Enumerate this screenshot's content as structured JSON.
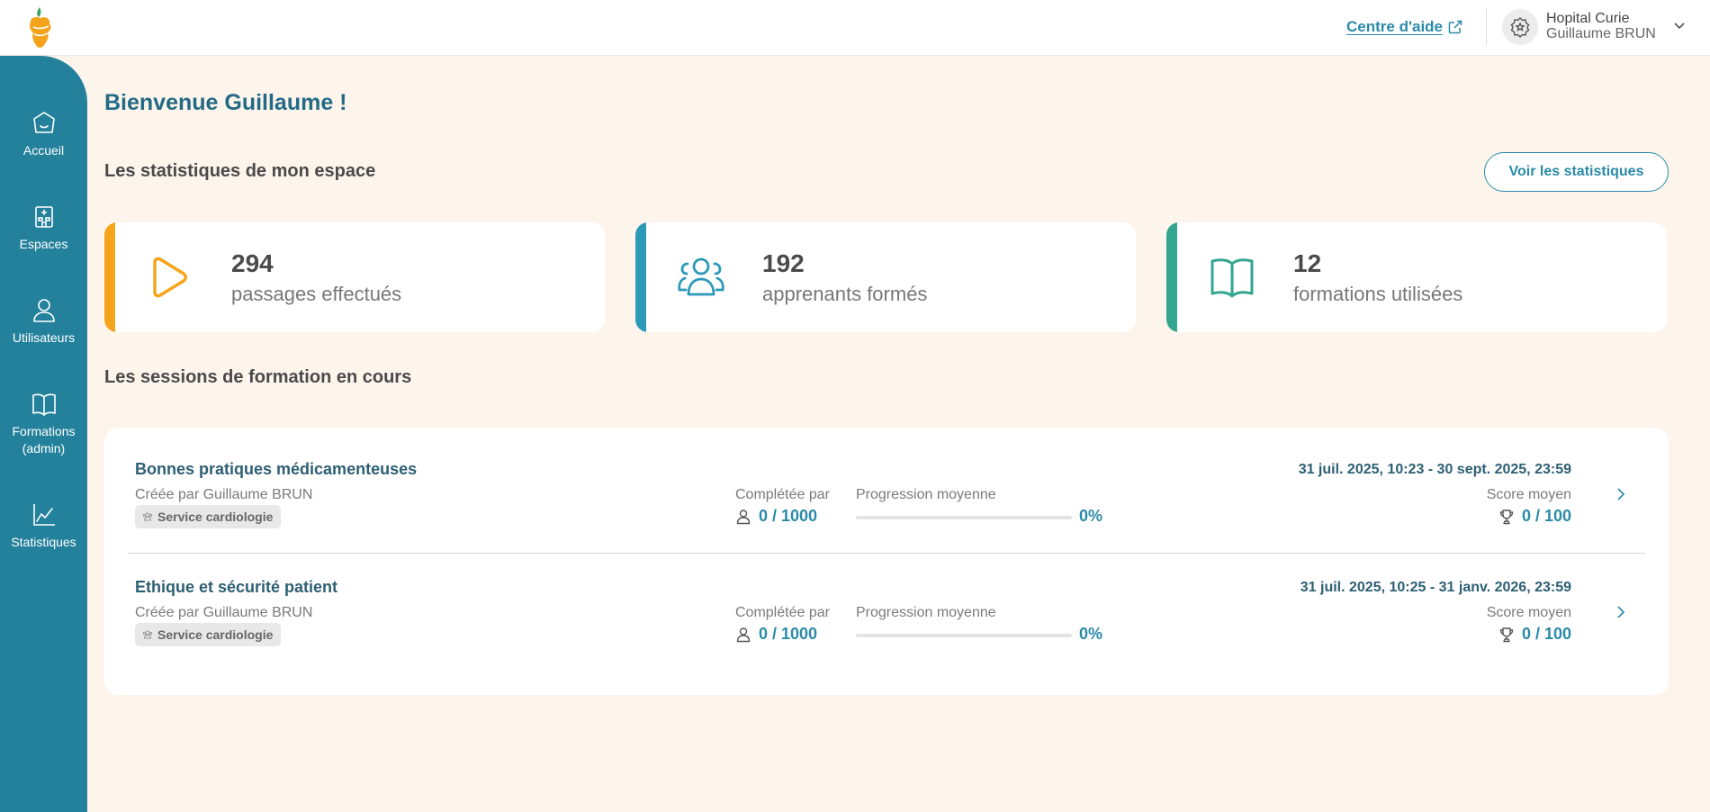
{
  "header": {
    "help_link": "Centre d'aide",
    "organization": "Hopital Curie",
    "user_name": "Guillaume BRUN"
  },
  "sidebar": {
    "items": [
      {
        "label": "Accueil",
        "icon": "home-icon"
      },
      {
        "label": "Espaces",
        "icon": "hospital-icon"
      },
      {
        "label": "Utilisateurs",
        "icon": "user-icon"
      },
      {
        "label": "Formations\n(admin)",
        "icon": "book-icon"
      },
      {
        "label": "Statistiques",
        "icon": "chart-icon"
      }
    ]
  },
  "main": {
    "welcome": "Bienvenue Guillaume !",
    "stats_section_title": "Les statistiques de mon espace",
    "stats_button": "Voir les statistiques",
    "stats": [
      {
        "value": "294",
        "label": "passages effectués",
        "accent": "#f5a31a",
        "icon": "play-icon"
      },
      {
        "value": "192",
        "label": "apprenants formés",
        "accent": "#2c9ab7",
        "icon": "group-icon"
      },
      {
        "value": "12",
        "label": "formations utilisées",
        "accent": "#34a58f",
        "icon": "book-icon"
      }
    ],
    "sessions_section_title": "Les sessions de formation en cours",
    "sessions": [
      {
        "title": "Bonnes pratiques médicamenteuses",
        "creator": "Créée par Guillaume BRUN",
        "tag": "Service cardiologie",
        "completed_label": "Complétée par",
        "completed_value": "0 / 1000",
        "progress_label": "Progression moyenne",
        "progress_pct": "0%",
        "progress_fraction": 0,
        "dates": "31 juil. 2025, 10:23 - 30 sept. 2025, 23:59",
        "score_label": "Score moyen",
        "score_value": "0 / 100"
      },
      {
        "title": "Ethique et sécurité patient",
        "creator": "Créée par Guillaume BRUN",
        "tag": "Service cardiologie",
        "completed_label": "Complétée par",
        "completed_value": "0 / 1000",
        "progress_label": "Progression moyenne",
        "progress_pct": "0%",
        "progress_fraction": 0,
        "dates": "31 juil. 2025, 10:25 - 31 janv. 2026, 23:59",
        "score_label": "Score moyen",
        "score_value": "0 / 100"
      }
    ]
  },
  "colors": {
    "primary": "#24819c",
    "link": "#2a8aa8",
    "background": "#fdf4ec"
  }
}
